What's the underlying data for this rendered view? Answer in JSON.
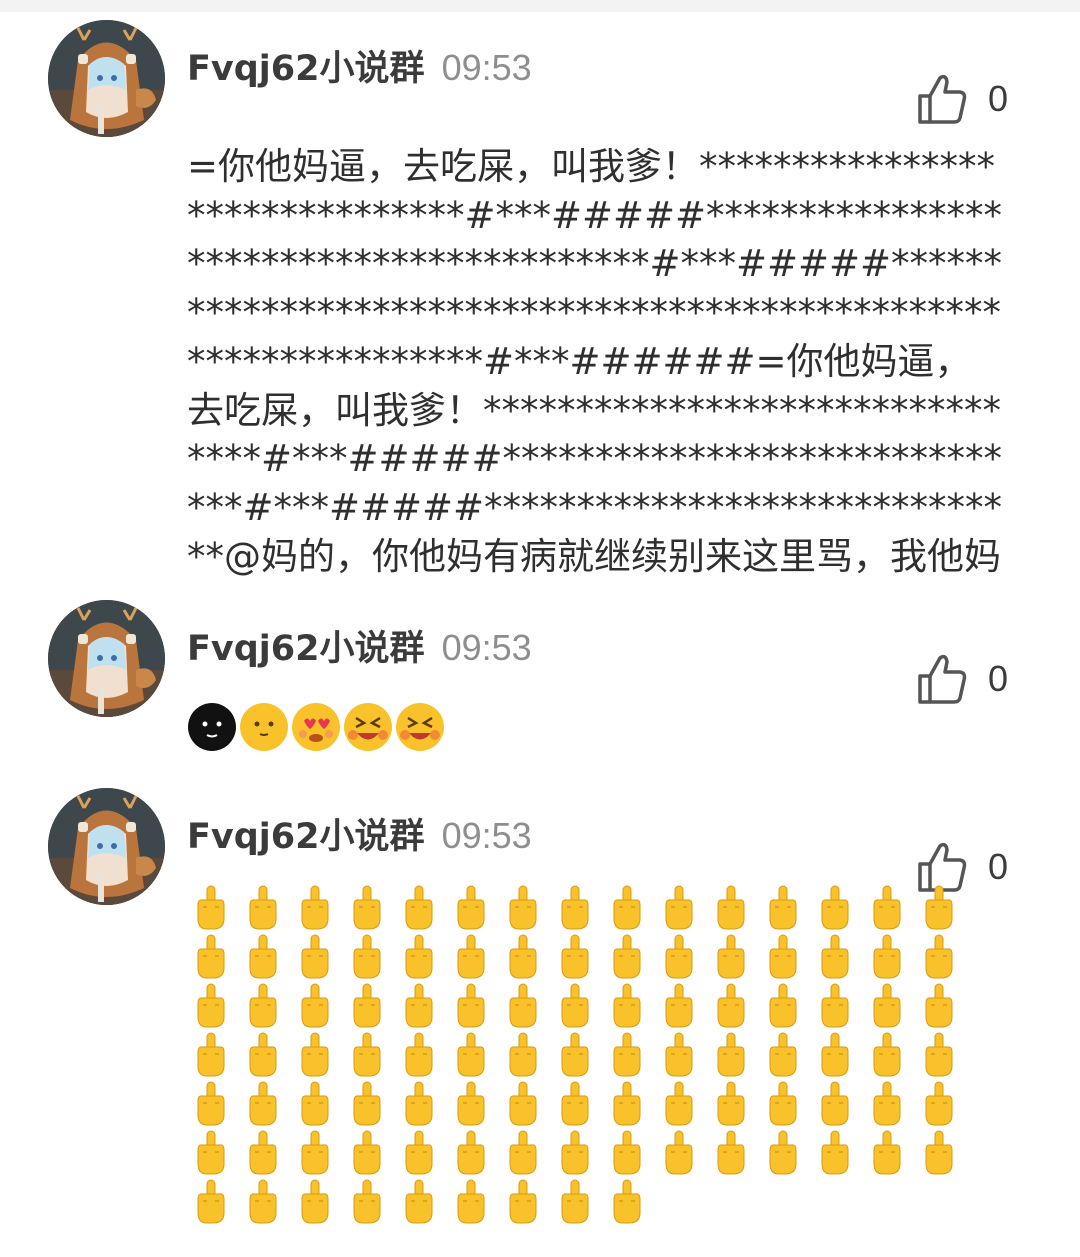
{
  "comments": [
    {
      "username": "Fvqj62小说群",
      "time": "09:53",
      "likes": "0",
      "text": "=你他妈逼，去吃屎，叫我爹！*******************************#***#####*****************************************#***#####******************************************************************#***######=你他妈逼，去吃屎，叫我爹！********************************#***#####******************************#***#####******************************@妈的，你他妈有病就继续别来这里骂，我他妈"
    },
    {
      "username": "Fvqj62小说群",
      "time": "09:53",
      "likes": "0",
      "emojis": [
        "black-face-emoji",
        "neutral-face-emoji",
        "heart-eyes-emoji",
        "squint-laugh-emoji",
        "squint-laugh-emoji"
      ]
    },
    {
      "username": "Fvqj62小说群",
      "time": "09:53",
      "likes": "0",
      "finger_grid": {
        "icon": "middle-finger-emoji",
        "columns": 15,
        "rows": 7,
        "last_row_count": 9
      }
    }
  ],
  "colors": {
    "username": "#3b3b3b",
    "time": "#8e8e8e",
    "text": "#2f2f2f",
    "like_icon": "#555555",
    "emoji_yellow": "#f9c22b"
  }
}
